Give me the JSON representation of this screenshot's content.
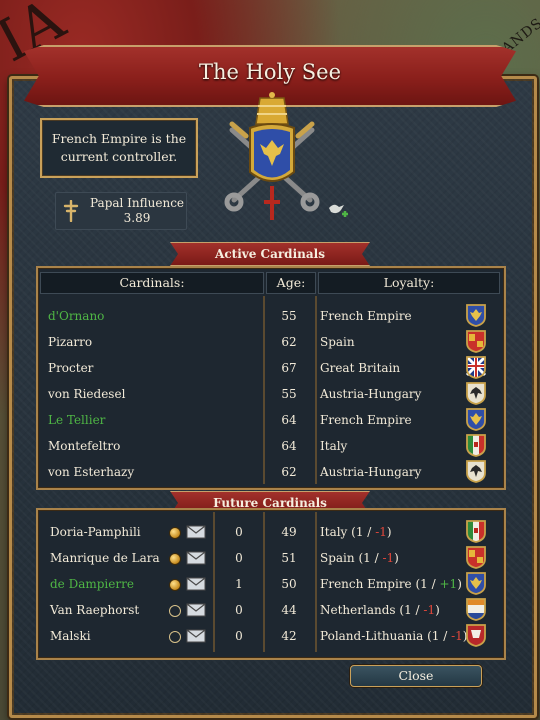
{
  "window": {
    "title": "The Holy See"
  },
  "controller_text": "French Empire is the current controller.",
  "influence": {
    "label": "Papal Influence",
    "value": "3.89"
  },
  "sections": {
    "active": "Active Cardinals",
    "future": "Future Cardinals"
  },
  "columns": {
    "cardinals": "Cardinals:",
    "age": "Age:",
    "loyalty": "Loyalty:"
  },
  "active_cardinals": [
    {
      "name": "d'Ornano",
      "age": "55",
      "loyalty": "French Empire",
      "highlight": true,
      "flag": "french-empire-flag-icon"
    },
    {
      "name": "Pizarro",
      "age": "62",
      "loyalty": "Spain",
      "highlight": false,
      "flag": "spain-flag-icon"
    },
    {
      "name": "Procter",
      "age": "67",
      "loyalty": "Great Britain",
      "highlight": false,
      "flag": "great-britain-flag-icon"
    },
    {
      "name": "von Riedesel",
      "age": "55",
      "loyalty": "Austria-Hungary",
      "highlight": false,
      "flag": "austria-hungary-flag-icon"
    },
    {
      "name": "Le Tellier",
      "age": "64",
      "loyalty": "French Empire",
      "highlight": true,
      "flag": "french-empire-flag-icon"
    },
    {
      "name": "Montefeltro",
      "age": "64",
      "loyalty": "Italy",
      "highlight": false,
      "flag": "italy-flag-icon"
    },
    {
      "name": "von Esterhazy",
      "age": "62",
      "loyalty": "Austria-Hungary",
      "highlight": false,
      "flag": "austria-hungary-flag-icon"
    }
  ],
  "future_cardinals": [
    {
      "name": "Doria-Pamphili",
      "invest": "gold",
      "count": "0",
      "age": "49",
      "loyalty": "Italy",
      "open": "(1 /",
      "delta": "-1",
      "close": ")",
      "highlight": false,
      "flag": "italy-flag-icon"
    },
    {
      "name": "Manrique de Lara",
      "invest": "gold",
      "count": "0",
      "age": "51",
      "loyalty": "Spain",
      "open": "(1 /",
      "delta": "-1",
      "close": ")",
      "highlight": false,
      "flag": "spain-flag-icon"
    },
    {
      "name": "de Dampierre",
      "invest": "gold",
      "count": "1",
      "age": "50",
      "loyalty": "French Empire",
      "open": "(1 /",
      "delta": "+1",
      "close": ")",
      "highlight": true,
      "flag": "french-empire-flag-icon"
    },
    {
      "name": "Van Raephorst",
      "invest": "empty",
      "count": "0",
      "age": "44",
      "loyalty": "Netherlands",
      "open": "(1 /",
      "delta": "-1",
      "close": ")",
      "highlight": false,
      "flag": "netherlands-flag-icon"
    },
    {
      "name": "Malski",
      "invest": "empty",
      "count": "0",
      "age": "42",
      "loyalty": "Poland-Lithuania",
      "open": "(1 /",
      "delta": "-1",
      "close": ")",
      "highlight": false,
      "flag": "poland-lithuania-flag-icon"
    }
  ],
  "map_labels": {
    "left": "IA",
    "right": "ANDS"
  },
  "close_label": "Close",
  "colors": {
    "panel": "#27323c",
    "gold_border": "#b58a4a",
    "ribbon_red": "#8a1f1b",
    "positive": "#4fb645",
    "negative": "#e2473b"
  }
}
